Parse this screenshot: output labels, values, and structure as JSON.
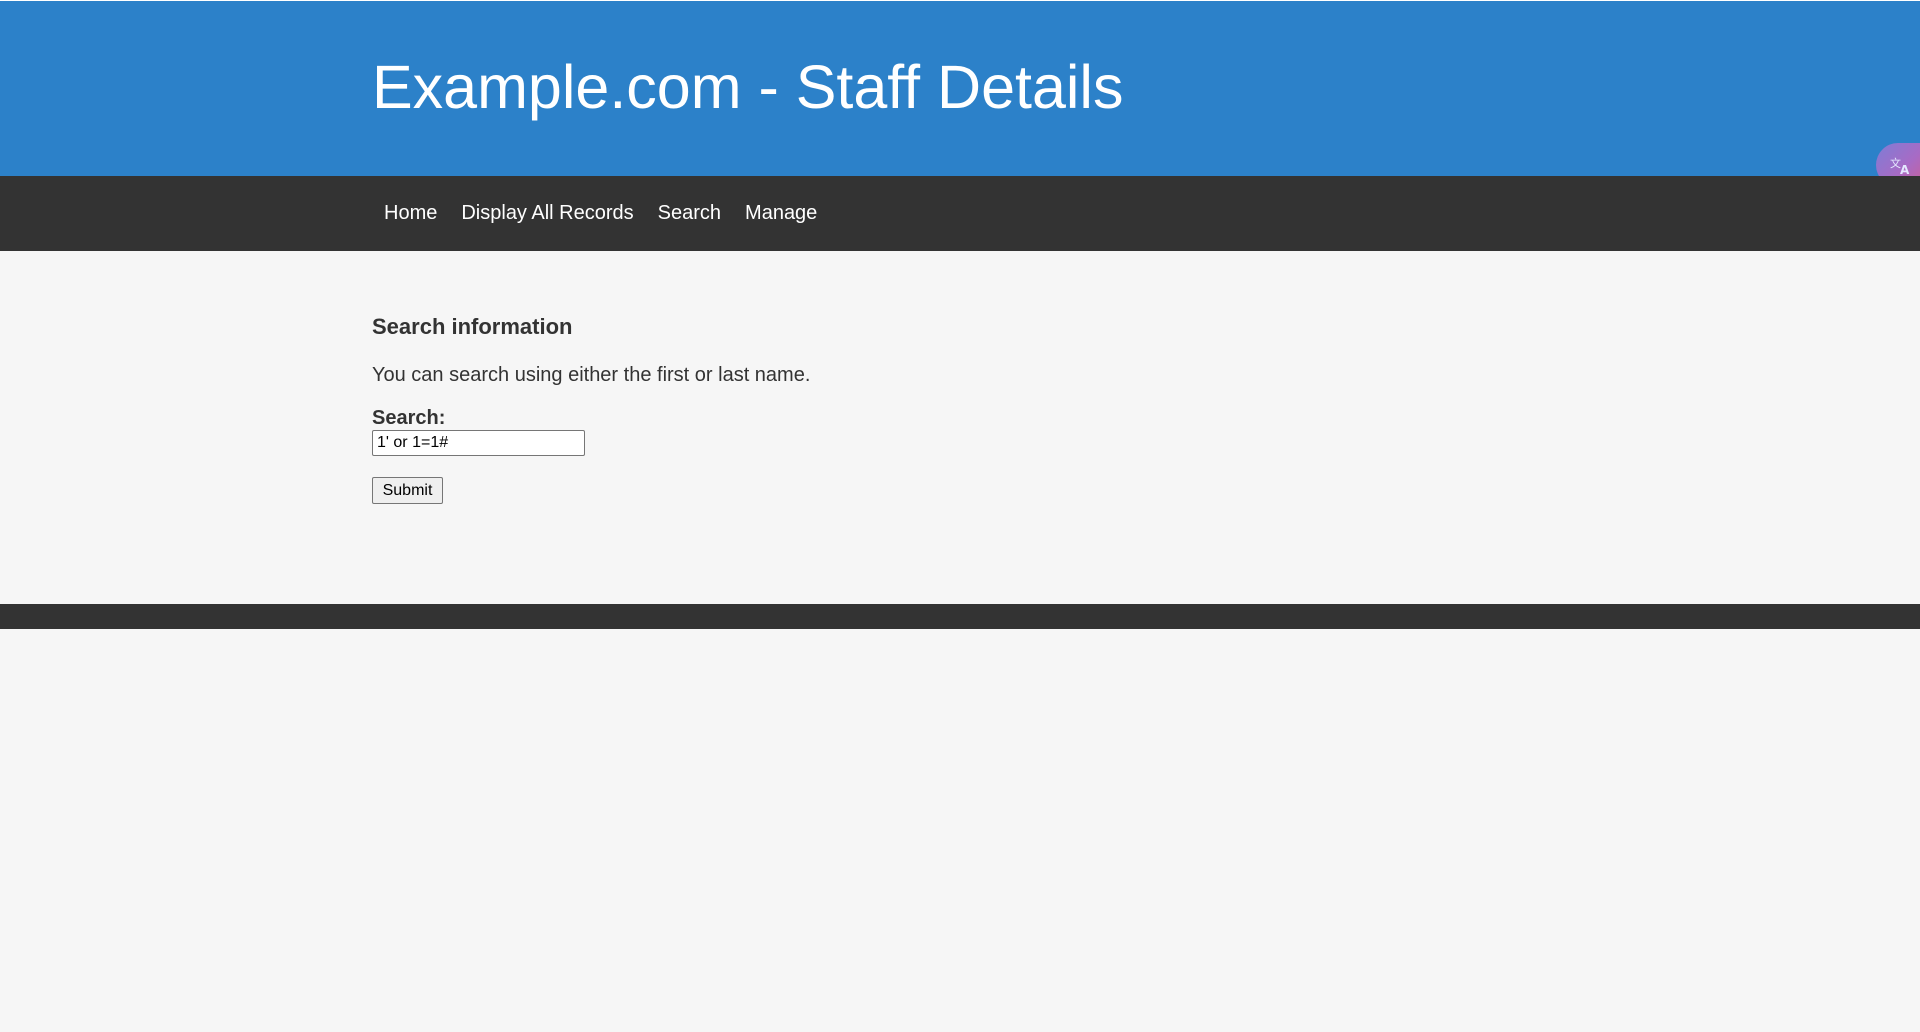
{
  "header": {
    "title": "Example.com - Staff Details"
  },
  "nav": {
    "items": [
      {
        "label": "Home"
      },
      {
        "label": "Display All Records"
      },
      {
        "label": "Search"
      },
      {
        "label": "Manage"
      }
    ]
  },
  "main": {
    "heading": "Search information",
    "intro": "You can search using either the first or last name.",
    "search_label": "Search:",
    "search_value": "1' or 1=1#",
    "submit_label": "Submit"
  },
  "widgets": {
    "translate_icon": "translate-icon"
  },
  "colors": {
    "header_bg": "#2c81c9",
    "nav_bg": "#333333",
    "page_bg": "#f6f6f6",
    "footer_bg": "#333333"
  }
}
